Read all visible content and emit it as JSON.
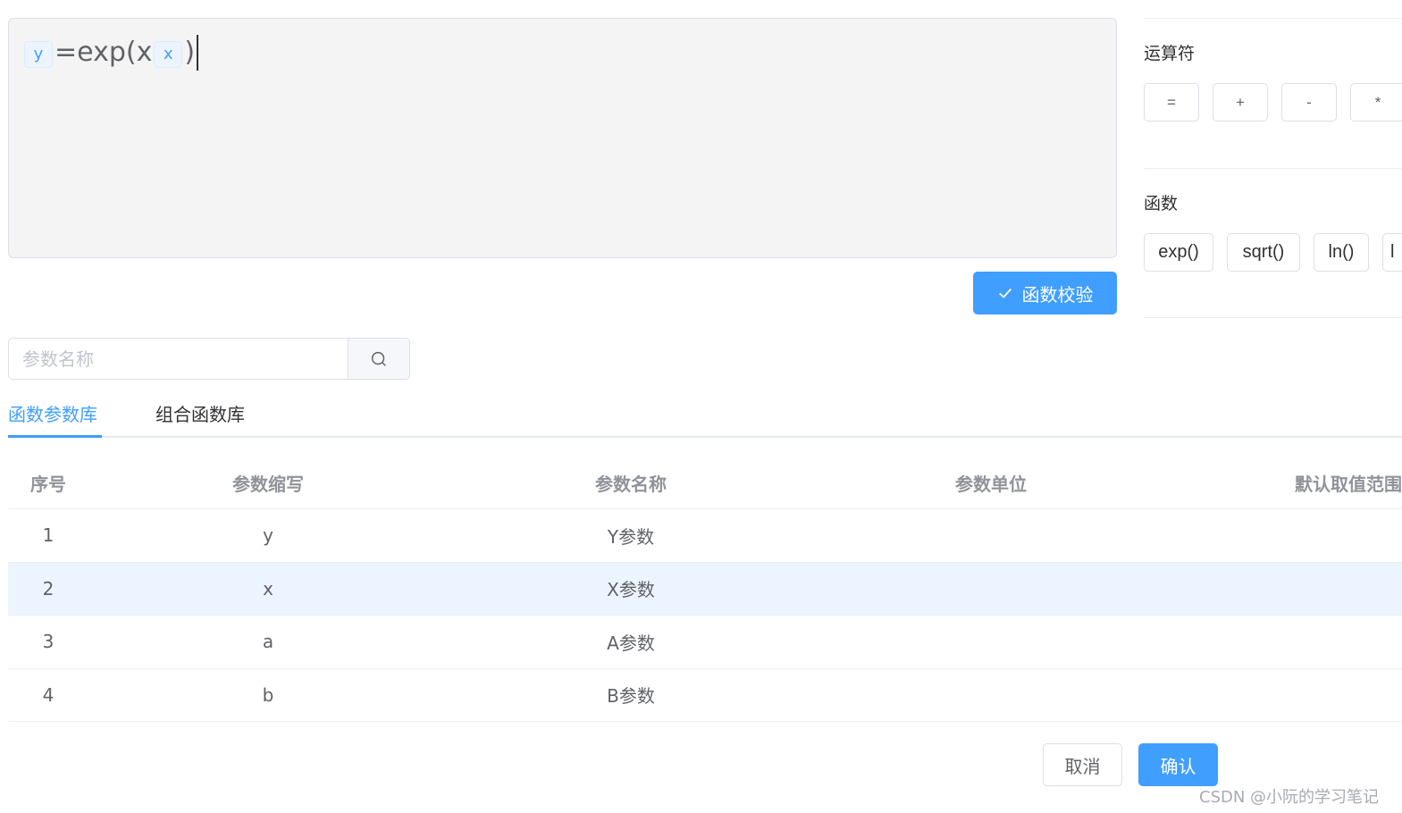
{
  "editor": {
    "tokens": [
      {
        "kind": "chip",
        "text": "y"
      },
      {
        "kind": "text",
        "text": "=exp(x"
      },
      {
        "kind": "chip",
        "text": "x"
      },
      {
        "kind": "text",
        "text": ")"
      }
    ]
  },
  "validate_button": {
    "label": "函数校验",
    "icon": "check-icon"
  },
  "panel": {
    "operators_title": "运算符",
    "operators": [
      "=",
      "+",
      "-",
      "*"
    ],
    "functions_title": "函数",
    "functions": [
      "exp()",
      "sqrt()",
      "ln()",
      "l"
    ]
  },
  "search": {
    "placeholder": "参数名称",
    "value": "",
    "icon": "search-icon"
  },
  "tabs": [
    {
      "label": "函数参数库",
      "active": true
    },
    {
      "label": "组合函数库",
      "active": false
    }
  ],
  "table": {
    "columns": [
      "序号",
      "参数缩写",
      "参数名称",
      "参数单位",
      "默认取值范围"
    ],
    "rows": [
      {
        "index": "1",
        "abbr": "y",
        "name": "Y参数",
        "unit": "",
        "range": ""
      },
      {
        "index": "2",
        "abbr": "x",
        "name": "X参数",
        "unit": "",
        "range": ""
      },
      {
        "index": "3",
        "abbr": "a",
        "name": "A参数",
        "unit": "",
        "range": ""
      },
      {
        "index": "4",
        "abbr": "b",
        "name": "B参数",
        "unit": "",
        "range": ""
      }
    ]
  },
  "footer": {
    "cancel_label": "取消",
    "confirm_label": "确认"
  },
  "watermark": "CSDN @小阮的学习笔记",
  "colors": {
    "primary": "#409eff",
    "hover_row": "#ecf5ff",
    "editor_bg": "#f4f4f4"
  }
}
